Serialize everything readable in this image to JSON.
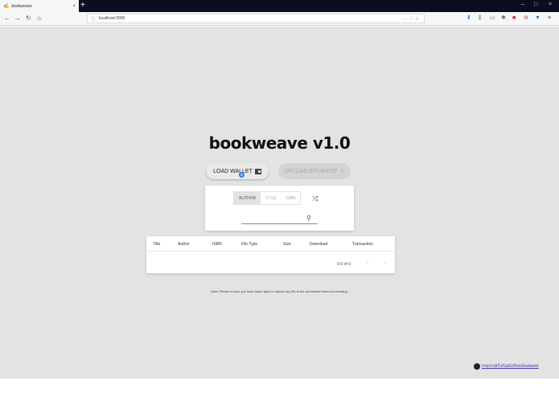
{
  "browser": {
    "tab_title": "bookweave",
    "tab_close": "×",
    "new_tab": "+",
    "url": "localhost:3000",
    "page_actions": "··· ♡ ☆",
    "window_controls": {
      "minimize": "–",
      "maximize": "□",
      "close": "×"
    }
  },
  "app": {
    "title": "bookweave v1.0",
    "load_wallet_label": "LOAD WALLET",
    "upload_label": "UPLOAD EPUB/PDF",
    "upload_icon": "⇪",
    "search": {
      "modes": [
        "AUTHOR",
        "TITLE",
        "ISBN"
      ],
      "active_mode": "AUTHOR",
      "shuffle_icon": "⤨",
      "placeholder": "",
      "search_icon": "⚲"
    },
    "table": {
      "columns": [
        "Title",
        "Author",
        "ISBN",
        "File Type",
        "Size",
        "Download",
        "Transaction"
      ],
      "pagination": "0-0 of 0",
      "prev": "‹",
      "next": "›"
    },
    "note": "Note: Please ensure you have legal rights to upload any file to the permaweb before proceeding.",
    "github_link": "marcojrfurtado/bookweave"
  }
}
